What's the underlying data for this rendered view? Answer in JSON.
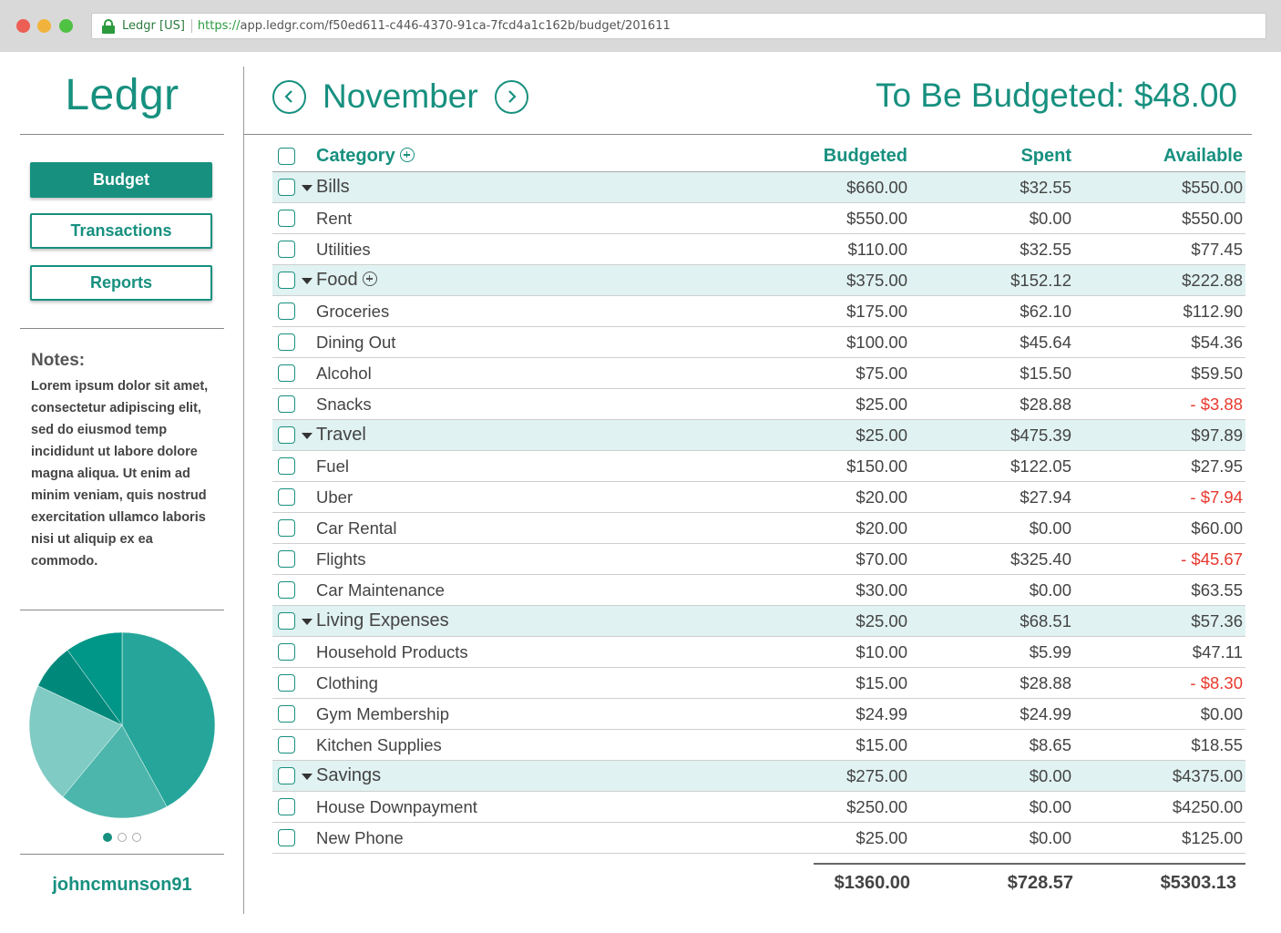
{
  "browser": {
    "site_label": "Ledgr [US]",
    "url_https": "https://",
    "url_rest": "app.ledgr.com/f50ed611-c446-4370-91ca-7fcd4a1c162b/budget/201611"
  },
  "sidebar": {
    "logo": "Ledgr",
    "nav": [
      {
        "label": "Budget",
        "active": true
      },
      {
        "label": "Transactions",
        "active": false
      },
      {
        "label": "Reports",
        "active": false
      }
    ],
    "notes_title": "Notes:",
    "notes_body": "Lorem ipsum dolor sit amet, consectetur adipiscing elit, sed do eiusmod temp incididunt ut labore dolore magna aliqua. Ut enim ad minim veniam, quis nostrud exercitation ullamco laboris nisi ut aliquip ex ea commodo.",
    "pie": {
      "slices": [
        0.42,
        0.19,
        0.21,
        0.08,
        0.1
      ],
      "colors": [
        "#26a69a",
        "#4db6ac",
        "#80cbc4",
        "#00897b",
        "#009688"
      ]
    },
    "pager": {
      "count": 3,
      "active": 0
    },
    "username": "johncmunson91"
  },
  "header": {
    "month": "November",
    "to_be_budgeted": "To Be Budgeted: $48.00"
  },
  "table": {
    "columns": {
      "category": "Category",
      "budgeted": "Budgeted",
      "spent": "Spent",
      "available": "Available"
    },
    "rows": [
      {
        "type": "group",
        "name": "Bills",
        "plus": false,
        "budgeted": "$660.00",
        "spent": "$32.55",
        "available": "$550.00",
        "neg": false
      },
      {
        "type": "item",
        "name": "Rent",
        "budgeted": "$550.00",
        "spent": "$0.00",
        "available": "$550.00",
        "neg": false
      },
      {
        "type": "item",
        "name": "Utilities",
        "budgeted": "$110.00",
        "spent": "$32.55",
        "available": "$77.45",
        "neg": false
      },
      {
        "type": "group",
        "name": "Food",
        "plus": true,
        "budgeted": "$375.00",
        "spent": "$152.12",
        "available": "$222.88",
        "neg": false
      },
      {
        "type": "item",
        "name": "Groceries",
        "budgeted": "$175.00",
        "spent": "$62.10",
        "available": "$112.90",
        "neg": false
      },
      {
        "type": "item",
        "name": "Dining Out",
        "budgeted": "$100.00",
        "spent": "$45.64",
        "available": "$54.36",
        "neg": false
      },
      {
        "type": "item",
        "name": "Alcohol",
        "budgeted": "$75.00",
        "spent": "$15.50",
        "available": "$59.50",
        "neg": false
      },
      {
        "type": "item",
        "name": "Snacks",
        "budgeted": "$25.00",
        "spent": "$28.88",
        "available": "- $3.88",
        "neg": true
      },
      {
        "type": "group",
        "name": "Travel",
        "plus": false,
        "budgeted": "$25.00",
        "spent": "$475.39",
        "available": "$97.89",
        "neg": false
      },
      {
        "type": "item",
        "name": "Fuel",
        "budgeted": "$150.00",
        "spent": "$122.05",
        "available": "$27.95",
        "neg": false
      },
      {
        "type": "item",
        "name": "Uber",
        "budgeted": "$20.00",
        "spent": "$27.94",
        "available": "- $7.94",
        "neg": true
      },
      {
        "type": "item",
        "name": "Car Rental",
        "budgeted": "$20.00",
        "spent": "$0.00",
        "available": "$60.00",
        "neg": false
      },
      {
        "type": "item",
        "name": "Flights",
        "budgeted": "$70.00",
        "spent": "$325.40",
        "available": "- $45.67",
        "neg": true
      },
      {
        "type": "item",
        "name": "Car Maintenance",
        "budgeted": "$30.00",
        "spent": "$0.00",
        "available": "$63.55",
        "neg": false
      },
      {
        "type": "group",
        "name": "Living Expenses",
        "plus": false,
        "budgeted": "$25.00",
        "spent": "$68.51",
        "available": "$57.36",
        "neg": false
      },
      {
        "type": "item",
        "name": "Household Products",
        "budgeted": "$10.00",
        "spent": "$5.99",
        "available": "$47.11",
        "neg": false
      },
      {
        "type": "item",
        "name": "Clothing",
        "budgeted": "$15.00",
        "spent": "$28.88",
        "available": "- $8.30",
        "neg": true
      },
      {
        "type": "item",
        "name": "Gym Membership",
        "budgeted": "$24.99",
        "spent": "$24.99",
        "available": "$0.00",
        "neg": false
      },
      {
        "type": "item",
        "name": "Kitchen Supplies",
        "budgeted": "$15.00",
        "spent": "$8.65",
        "available": "$18.55",
        "neg": false
      },
      {
        "type": "group",
        "name": "Savings",
        "plus": false,
        "budgeted": "$275.00",
        "spent": "$0.00",
        "available": "$4375.00",
        "neg": false
      },
      {
        "type": "item",
        "name": "House Downpayment",
        "budgeted": "$250.00",
        "spent": "$0.00",
        "available": "$4250.00",
        "neg": false
      },
      {
        "type": "item",
        "name": "New Phone",
        "budgeted": "$25.00",
        "spent": "$0.00",
        "available": "$125.00",
        "neg": false
      }
    ],
    "totals": {
      "budgeted": "$1360.00",
      "spent": "$728.57",
      "available": "$5303.13"
    }
  }
}
